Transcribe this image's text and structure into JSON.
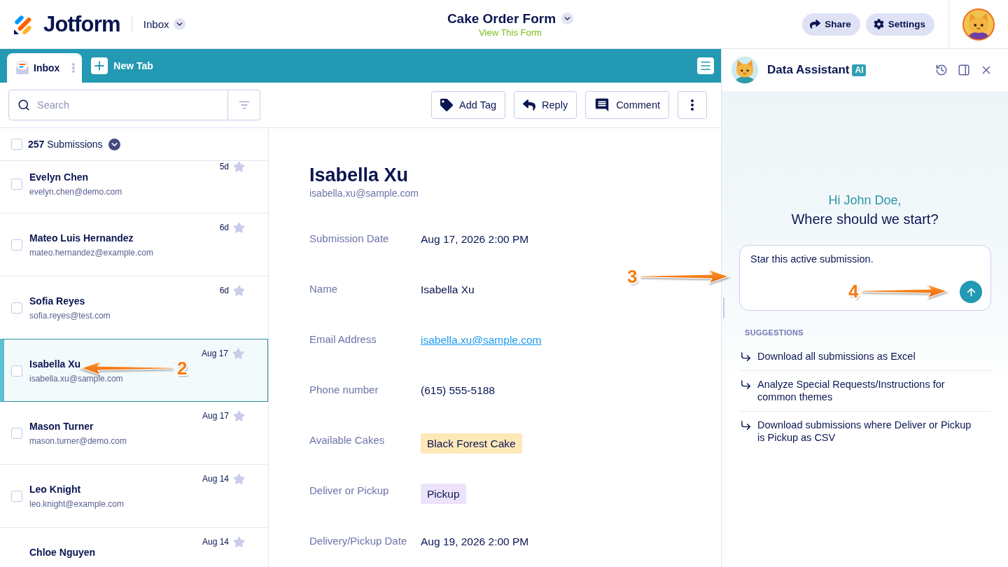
{
  "header": {
    "logo": "Jotform",
    "section": "Inbox",
    "form_title": "Cake Order Form",
    "form_link": "View This Form",
    "buttons": [
      {
        "kind": "share",
        "label": "Share"
      },
      {
        "kind": "settings",
        "label": "Settings"
      }
    ]
  },
  "tabs": [
    {
      "label": "Inbox",
      "selected": true
    }
  ],
  "new_tab": {
    "label": "New Tab"
  },
  "search": {
    "placeholder": "Search"
  },
  "actions": [
    {
      "kind": "tag",
      "label": "Add Tag"
    },
    {
      "kind": "reply",
      "label": "Reply"
    },
    {
      "kind": "comment",
      "label": "Comment"
    },
    {
      "kind": "more"
    }
  ],
  "list_header": {
    "count_text": "**257** Submissions",
    "checked": false
  },
  "submissions": [
    {
      "name": "Evelyn Chen",
      "email": "evelyn.chen@demo.com",
      "time": "5d",
      "selected": false,
      "checked": false,
      "starred": false
    },
    {
      "name": "Mateo Luis Hernandez",
      "email": "mateo.hernandez@example.com",
      "time": "6d",
      "selected": false,
      "checked": false,
      "starred": false
    },
    {
      "name": "Sofia Reyes",
      "email": "sofia.reyes@test.com",
      "time": "6d",
      "selected": false,
      "checked": false,
      "starred": false
    },
    {
      "name": "Isabella Xu",
      "email": "isabella.xu@sample.com",
      "time": "Aug 17",
      "selected": true,
      "checked": false,
      "starred": false
    },
    {
      "name": "Mason Turner",
      "email": "mason.turner@demo.com",
      "time": "Aug 17",
      "selected": false,
      "checked": false,
      "starred": false
    },
    {
      "name": "Leo Knight",
      "email": "leo.knight@example.com",
      "time": "Aug 14",
      "selected": false,
      "checked": false,
      "starred": false
    },
    {
      "name": "Chloe Nguyen",
      "time": "Aug 14",
      "selected": false,
      "starred": false
    }
  ],
  "detail": {
    "name": "Isabella Xu",
    "email": "isabella.xu@sample.com",
    "fields": [
      {
        "label": "Submission Date",
        "value": "Aug 17, 2026 2:00 PM",
        "kind": "text"
      },
      {
        "label": "Name",
        "value": "Isabella Xu",
        "kind": "text"
      },
      {
        "label": "Email Address",
        "value": "isabella.xu@sample.com",
        "kind": "link"
      },
      {
        "label": "Phone number",
        "value": "(615) 555-5188",
        "kind": "text"
      },
      {
        "label": "Available Cakes",
        "value": "Black Forest Cake",
        "kind": "tag",
        "color": "#ffe8b8"
      },
      {
        "label": "Deliver or Pickup",
        "value": "Pickup",
        "kind": "tag",
        "color": "#ece3fb"
      },
      {
        "label": "Delivery/Pickup Date",
        "value": "Aug 19, 2026 2:00 PM",
        "kind": "text"
      }
    ]
  },
  "assistant": {
    "title": "Data Assistant",
    "badge": "AI",
    "greeting": "Hi John Doe,",
    "question": "Where should we start?",
    "prompt": {
      "value": "Star this active submission."
    },
    "suggestions_heading": "SUGGESTIONS",
    "suggestions": [
      "Download all submissions as Excel",
      "Analyze Special Requests/Instructions for common themes",
      "Download submissions where Deliver or Pickup is Pickup as CSV"
    ]
  },
  "annotations": [
    {
      "number": "2"
    },
    {
      "number": "3"
    },
    {
      "number": "4"
    }
  ]
}
